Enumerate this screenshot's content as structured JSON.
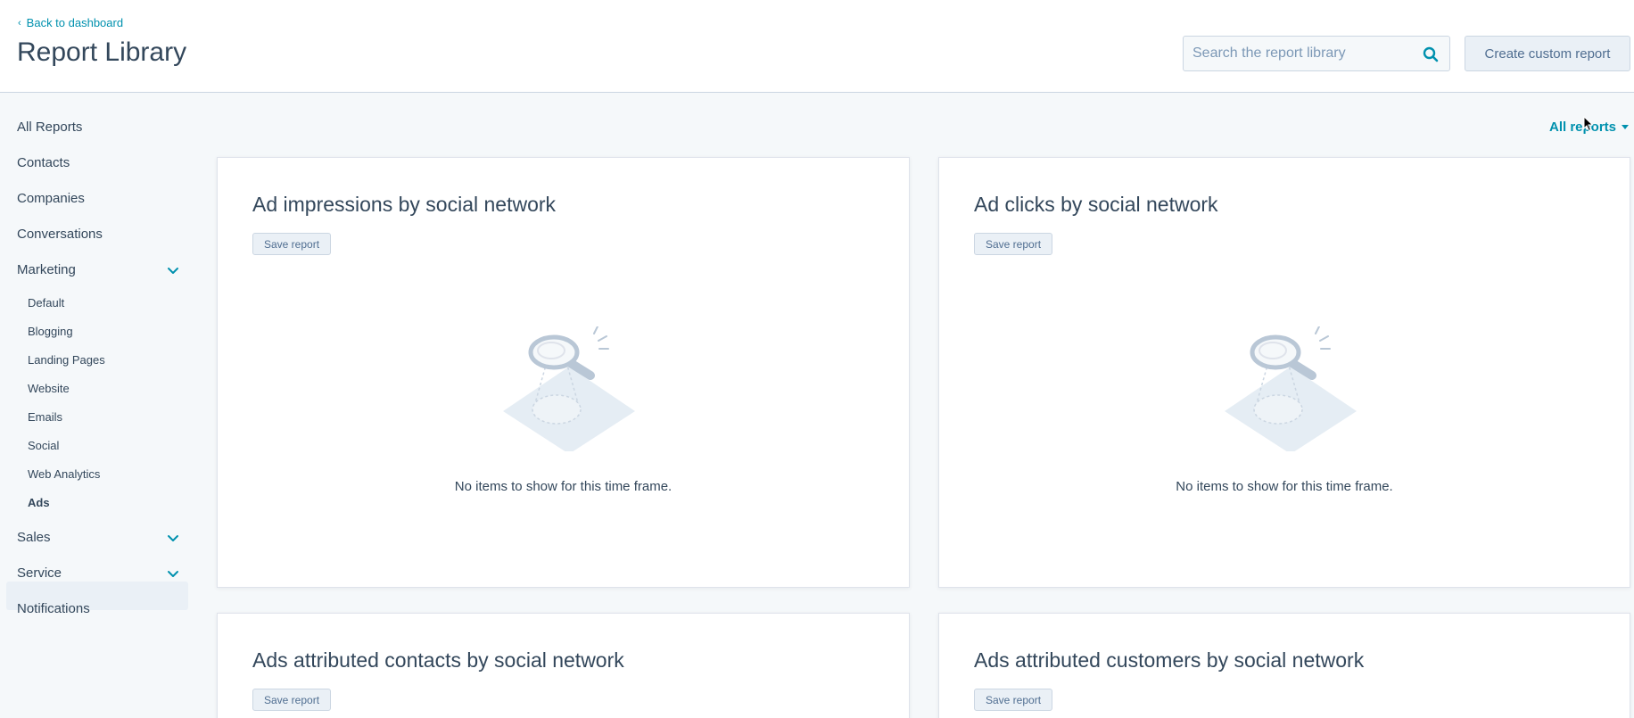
{
  "header": {
    "back_label": "Back to dashboard",
    "title": "Report Library",
    "search_placeholder": "Search the report library",
    "create_label": "Create custom report"
  },
  "sidebar": {
    "items": [
      {
        "label": "All Reports"
      },
      {
        "label": "Contacts"
      },
      {
        "label": "Companies"
      },
      {
        "label": "Conversations"
      },
      {
        "label": "Marketing"
      },
      {
        "label": "Sales"
      },
      {
        "label": "Service"
      },
      {
        "label": "Notifications"
      }
    ],
    "marketing_sub": [
      {
        "label": "Default"
      },
      {
        "label": "Blogging"
      },
      {
        "label": "Landing Pages"
      },
      {
        "label": "Website"
      },
      {
        "label": "Emails"
      },
      {
        "label": "Social"
      },
      {
        "label": "Web Analytics"
      },
      {
        "label": "Ads"
      }
    ]
  },
  "main": {
    "filter_label": "All reports",
    "cards": [
      {
        "title": "Ad impressions by social network",
        "save_label": "Save report",
        "empty_text": "No items to show for this time frame."
      },
      {
        "title": "Ad clicks by social network",
        "save_label": "Save report",
        "empty_text": "No items to show for this time frame."
      },
      {
        "title": "Ads attributed contacts by social network",
        "save_label": "Save report"
      },
      {
        "title": "Ads attributed customers by social network",
        "save_label": "Save report"
      }
    ]
  },
  "colors": {
    "accent": "#0091ae",
    "text": "#33475b",
    "background": "#f5f8fa"
  }
}
